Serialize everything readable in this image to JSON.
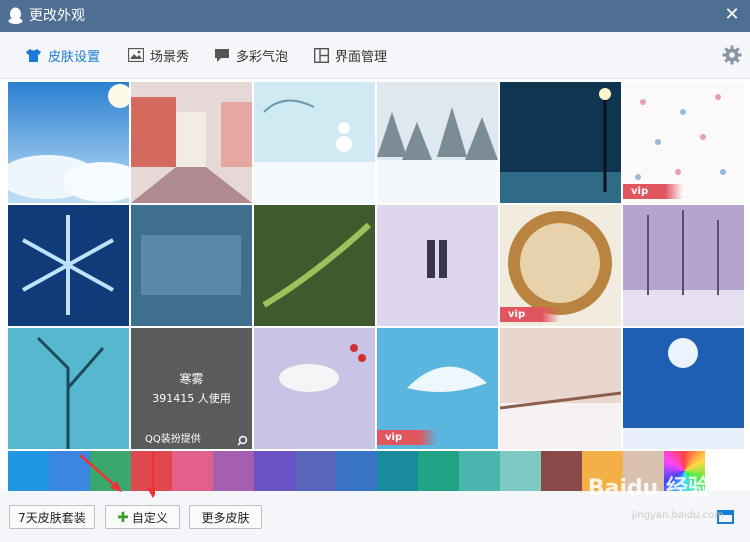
{
  "window": {
    "title": "更改外观",
    "close_label": "✕"
  },
  "tabs": [
    {
      "label": "皮肤设置",
      "icon": "shirt-icon",
      "active": true
    },
    {
      "label": "场景秀",
      "icon": "image-icon",
      "active": false
    },
    {
      "label": "多彩气泡",
      "icon": "bubble-icon",
      "active": false
    },
    {
      "label": "界面管理",
      "icon": "layout-icon",
      "active": false
    }
  ],
  "hover_tile": {
    "name": "寒雾",
    "users": "391415 人使用",
    "provider": "QQ装扮提供"
  },
  "vip_label": "vip",
  "swatch_colors": [
    "#2196e3",
    "#3a86e0",
    "#3aa86e",
    "#e0484f",
    "#e2608a",
    "#a55fb0",
    "#6a52c4",
    "#5a64b8",
    "#3a74c4",
    "#1a8a9e",
    "#22a386",
    "#4bb5b0",
    "#7ec9c3",
    "#8b4a4a",
    "#f3b047",
    "#d9c2b0",
    "rainbow"
  ],
  "footer": {
    "seven_day_label": "7天皮肤套装",
    "custom_label": "自定义",
    "more_label": "更多皮肤"
  },
  "watermark": {
    "main": "Baidu 经验",
    "sub": "jingyan.baidu.com"
  }
}
